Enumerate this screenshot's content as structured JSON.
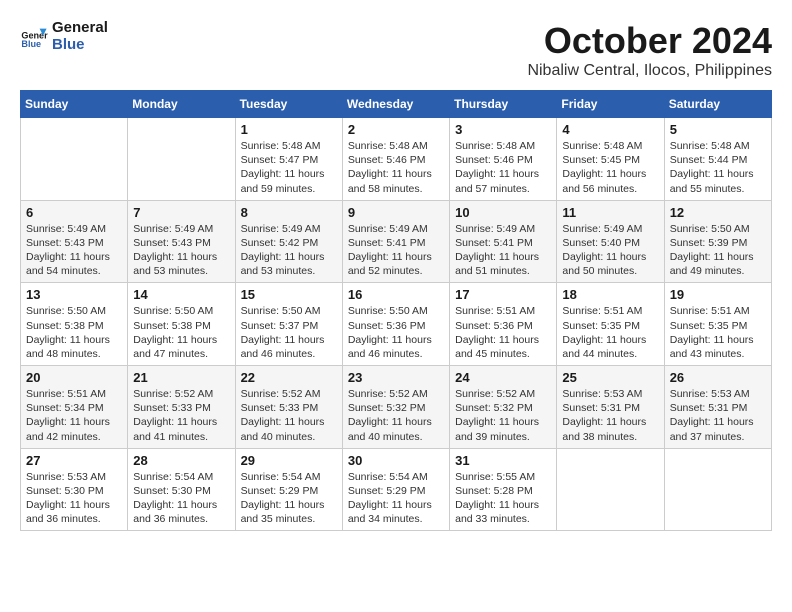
{
  "logo": {
    "line1": "General",
    "line2": "Blue"
  },
  "title": "October 2024",
  "location": "Nibaliw Central, Ilocos, Philippines",
  "weekdays": [
    "Sunday",
    "Monday",
    "Tuesday",
    "Wednesday",
    "Thursday",
    "Friday",
    "Saturday"
  ],
  "weeks": [
    [
      null,
      null,
      {
        "day": 1,
        "sunrise": "5:48 AM",
        "sunset": "5:47 PM",
        "daylight": "11 hours and 59 minutes."
      },
      {
        "day": 2,
        "sunrise": "5:48 AM",
        "sunset": "5:46 PM",
        "daylight": "11 hours and 58 minutes."
      },
      {
        "day": 3,
        "sunrise": "5:48 AM",
        "sunset": "5:46 PM",
        "daylight": "11 hours and 57 minutes."
      },
      {
        "day": 4,
        "sunrise": "5:48 AM",
        "sunset": "5:45 PM",
        "daylight": "11 hours and 56 minutes."
      },
      {
        "day": 5,
        "sunrise": "5:48 AM",
        "sunset": "5:44 PM",
        "daylight": "11 hours and 55 minutes."
      }
    ],
    [
      {
        "day": 6,
        "sunrise": "5:49 AM",
        "sunset": "5:43 PM",
        "daylight": "11 hours and 54 minutes."
      },
      {
        "day": 7,
        "sunrise": "5:49 AM",
        "sunset": "5:43 PM",
        "daylight": "11 hours and 53 minutes."
      },
      {
        "day": 8,
        "sunrise": "5:49 AM",
        "sunset": "5:42 PM",
        "daylight": "11 hours and 53 minutes."
      },
      {
        "day": 9,
        "sunrise": "5:49 AM",
        "sunset": "5:41 PM",
        "daylight": "11 hours and 52 minutes."
      },
      {
        "day": 10,
        "sunrise": "5:49 AM",
        "sunset": "5:41 PM",
        "daylight": "11 hours and 51 minutes."
      },
      {
        "day": 11,
        "sunrise": "5:49 AM",
        "sunset": "5:40 PM",
        "daylight": "11 hours and 50 minutes."
      },
      {
        "day": 12,
        "sunrise": "5:50 AM",
        "sunset": "5:39 PM",
        "daylight": "11 hours and 49 minutes."
      }
    ],
    [
      {
        "day": 13,
        "sunrise": "5:50 AM",
        "sunset": "5:38 PM",
        "daylight": "11 hours and 48 minutes."
      },
      {
        "day": 14,
        "sunrise": "5:50 AM",
        "sunset": "5:38 PM",
        "daylight": "11 hours and 47 minutes."
      },
      {
        "day": 15,
        "sunrise": "5:50 AM",
        "sunset": "5:37 PM",
        "daylight": "11 hours and 46 minutes."
      },
      {
        "day": 16,
        "sunrise": "5:50 AM",
        "sunset": "5:36 PM",
        "daylight": "11 hours and 46 minutes."
      },
      {
        "day": 17,
        "sunrise": "5:51 AM",
        "sunset": "5:36 PM",
        "daylight": "11 hours and 45 minutes."
      },
      {
        "day": 18,
        "sunrise": "5:51 AM",
        "sunset": "5:35 PM",
        "daylight": "11 hours and 44 minutes."
      },
      {
        "day": 19,
        "sunrise": "5:51 AM",
        "sunset": "5:35 PM",
        "daylight": "11 hours and 43 minutes."
      }
    ],
    [
      {
        "day": 20,
        "sunrise": "5:51 AM",
        "sunset": "5:34 PM",
        "daylight": "11 hours and 42 minutes."
      },
      {
        "day": 21,
        "sunrise": "5:52 AM",
        "sunset": "5:33 PM",
        "daylight": "11 hours and 41 minutes."
      },
      {
        "day": 22,
        "sunrise": "5:52 AM",
        "sunset": "5:33 PM",
        "daylight": "11 hours and 40 minutes."
      },
      {
        "day": 23,
        "sunrise": "5:52 AM",
        "sunset": "5:32 PM",
        "daylight": "11 hours and 40 minutes."
      },
      {
        "day": 24,
        "sunrise": "5:52 AM",
        "sunset": "5:32 PM",
        "daylight": "11 hours and 39 minutes."
      },
      {
        "day": 25,
        "sunrise": "5:53 AM",
        "sunset": "5:31 PM",
        "daylight": "11 hours and 38 minutes."
      },
      {
        "day": 26,
        "sunrise": "5:53 AM",
        "sunset": "5:31 PM",
        "daylight": "11 hours and 37 minutes."
      }
    ],
    [
      {
        "day": 27,
        "sunrise": "5:53 AM",
        "sunset": "5:30 PM",
        "daylight": "11 hours and 36 minutes."
      },
      {
        "day": 28,
        "sunrise": "5:54 AM",
        "sunset": "5:30 PM",
        "daylight": "11 hours and 36 minutes."
      },
      {
        "day": 29,
        "sunrise": "5:54 AM",
        "sunset": "5:29 PM",
        "daylight": "11 hours and 35 minutes."
      },
      {
        "day": 30,
        "sunrise": "5:54 AM",
        "sunset": "5:29 PM",
        "daylight": "11 hours and 34 minutes."
      },
      {
        "day": 31,
        "sunrise": "5:55 AM",
        "sunset": "5:28 PM",
        "daylight": "11 hours and 33 minutes."
      },
      null,
      null
    ]
  ],
  "labels": {
    "sunrise": "Sunrise:",
    "sunset": "Sunset:",
    "daylight": "Daylight:"
  }
}
